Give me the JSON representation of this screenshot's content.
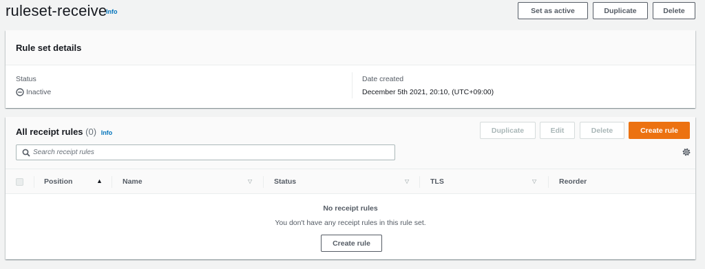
{
  "page": {
    "title": "ruleset-receive",
    "info": "Info",
    "actions": {
      "set_active": "Set as active",
      "duplicate": "Duplicate",
      "delete": "Delete"
    }
  },
  "details": {
    "title": "Rule set details",
    "status_label": "Status",
    "status_value": "Inactive",
    "date_label": "Date created",
    "date_value": "December 5th 2021, 20:10, (UTC+09:00)"
  },
  "rules": {
    "title": "All receipt rules",
    "count": "(0)",
    "info": "Info",
    "actions": {
      "duplicate": "Duplicate",
      "edit": "Edit",
      "delete": "Delete",
      "create": "Create rule"
    },
    "search_placeholder": "Search receipt rules",
    "columns": [
      "Position",
      "Name",
      "Status",
      "TLS",
      "Reorder"
    ],
    "empty": {
      "title": "No receipt rules",
      "description": "You don't have any receipt rules in this rule set.",
      "button": "Create rule"
    }
  },
  "colors": {
    "accent": "#ec7211",
    "link": "#0073bb",
    "background": "#f2f3f3"
  },
  "icons": [
    "search-icon",
    "gear-icon",
    "inactive-status-icon",
    "sort-ascending-icon",
    "sort-icon"
  ]
}
